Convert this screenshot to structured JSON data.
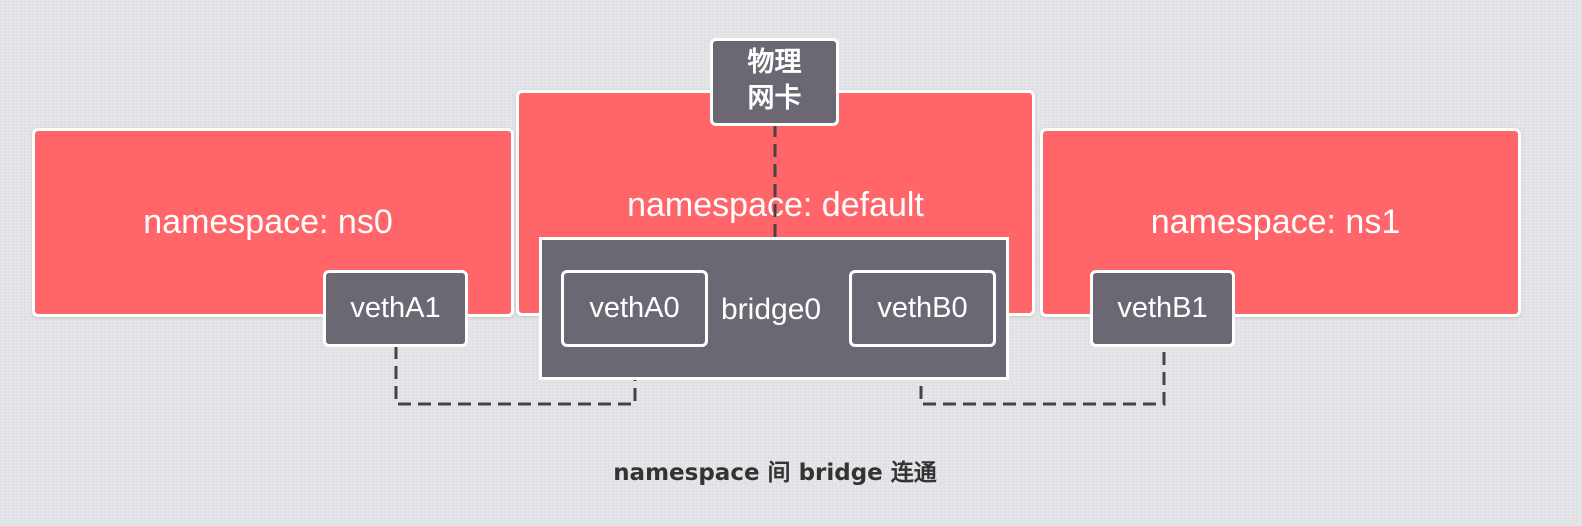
{
  "diagram": {
    "namespaces": {
      "ns0": "namespace: ns0",
      "default": "namespace: default",
      "ns1": "namespace: ns1"
    },
    "physical_nic": {
      "line1": "物理",
      "line2": "网卡"
    },
    "bridge": {
      "label": "bridge0"
    },
    "veths": {
      "vethA1": "vethA1",
      "vethA0": "vethA0",
      "vethB0": "vethB0",
      "vethB1": "vethB1"
    },
    "caption": "namespace 间 bridge 连通"
  },
  "colors": {
    "namespace_fill": "#ff6569",
    "device_fill": "#6c6873",
    "border": "#ffffff",
    "connector": "#444444",
    "background": "#e2e3e6"
  }
}
